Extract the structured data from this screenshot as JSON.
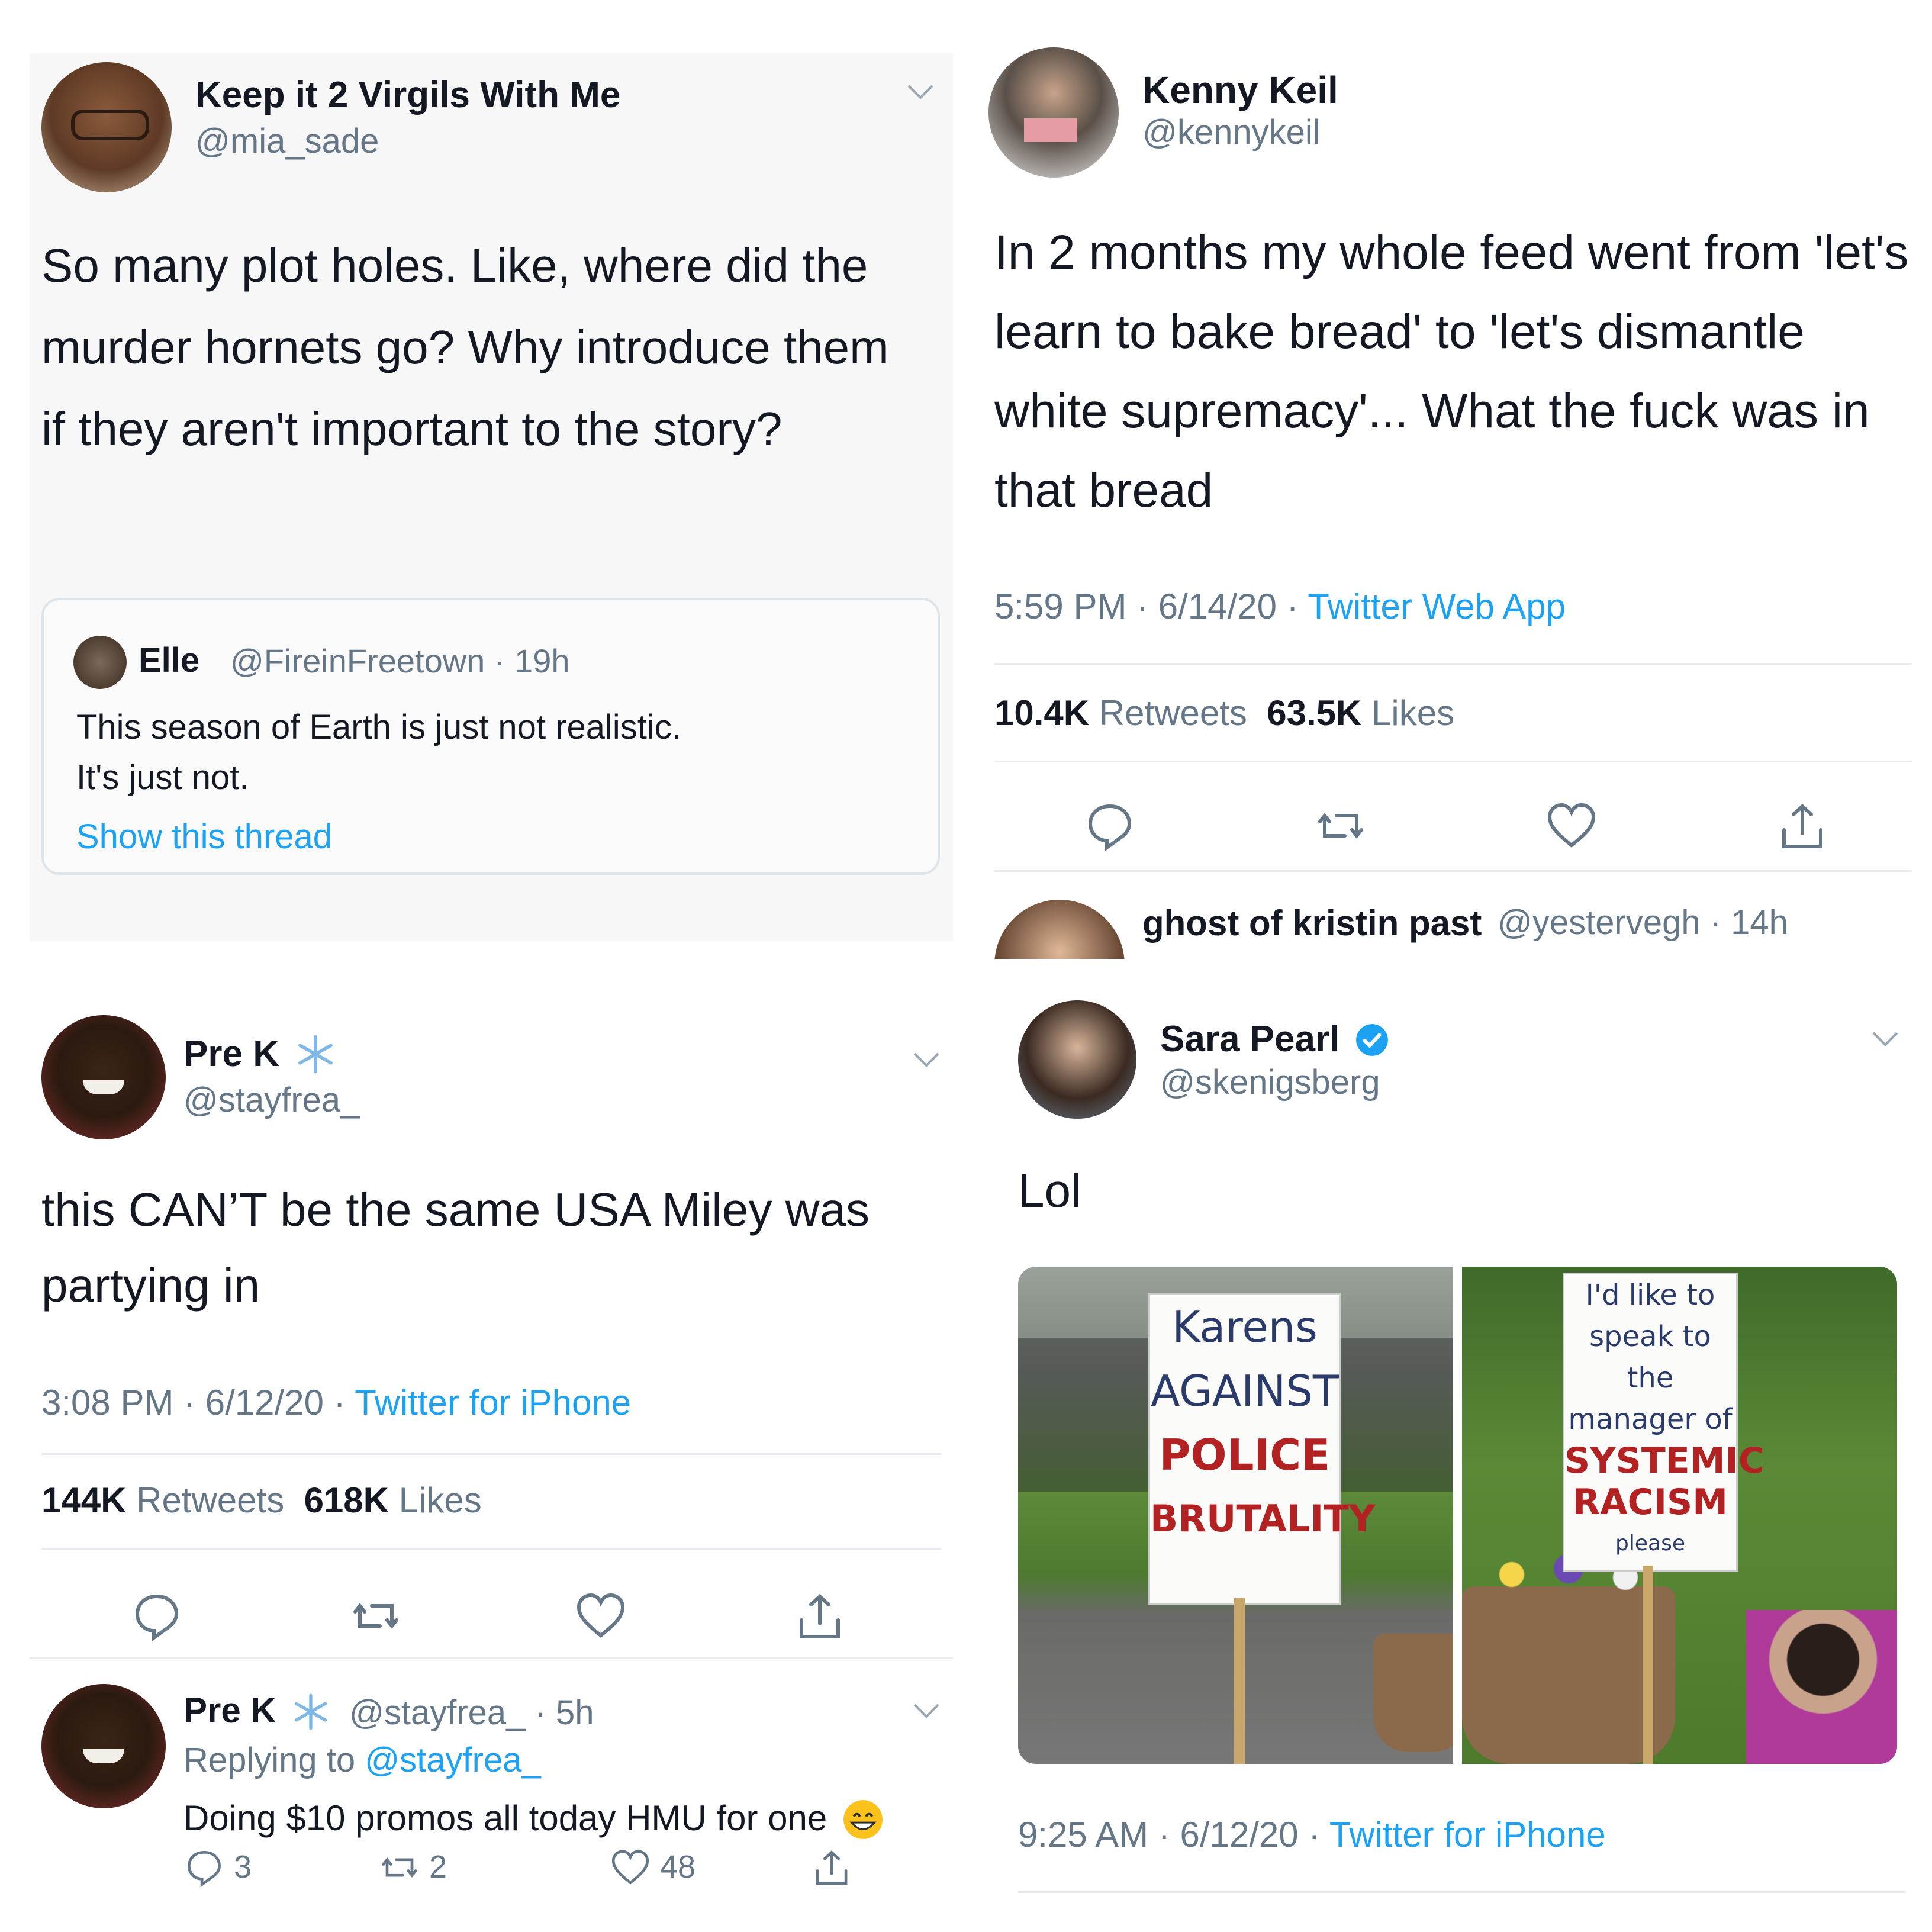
{
  "colors": {
    "accent": "#1da1f2",
    "text": "#141823",
    "muted": "#657786",
    "divider": "#e6ecf0",
    "verified": "#1da1f2"
  },
  "icons": [
    "chevron-down-icon",
    "reply-icon",
    "retweet-icon",
    "like-icon",
    "share-icon",
    "snowflake-icon",
    "verified-icon",
    "grin-emoji-icon"
  ],
  "tweet1": {
    "name": "Keep it 2 Virgils With Me",
    "handle": "@mia_sade",
    "text": "So many plot holes. Like, where did the murder hornets go? Why introduce them if they aren't important to the story?",
    "quote": {
      "name": "Elle",
      "handle_time": "@FireinFreetown · 19h",
      "line1": "This season of Earth is just not realistic.",
      "line2": "It's just not.",
      "show_thread": "Show this thread"
    }
  },
  "tweet2": {
    "name": "Kenny Keil",
    "handle": "@kennykeil",
    "text": "In 2 months my whole feed went from 'let's learn to bake bread' to 'let's dismantle white supremacy'... What the fuck was in that bread",
    "time": "5:59 PM · 6/14/20 · ",
    "source": "Twitter Web App",
    "retweets_count": "10.4K",
    "retweets_label": "Retweets",
    "likes_count": "63.5K",
    "likes_label": "Likes",
    "next_reply": {
      "name": "ghost of kristin past",
      "handle_time": "@yestervegh · 14h"
    }
  },
  "tweet3": {
    "name": "Pre K",
    "handle": "@stayfrea_",
    "text": "this CAN’T be the same USA Miley was partying in",
    "time": "3:08 PM · 6/12/20 · ",
    "source": "Twitter for iPhone",
    "retweets_count": "144K",
    "retweets_label": "Retweets",
    "likes_count": "618K",
    "likes_label": "Likes",
    "reply": {
      "name": "Pre K",
      "handle_time": "@stayfrea_ · 5h",
      "replying_prefix": "Replying to ",
      "replying_handle": "@stayfrea_",
      "text": "Doing $10 promos all today HMU for one",
      "reply_count": "3",
      "retweet_count": "2",
      "like_count": "48"
    }
  },
  "tweet4": {
    "name": "Sara Pearl",
    "handle": "@skenigsberg",
    "text": "Lol",
    "time": "9:25 AM · 6/12/20 · ",
    "source": "Twitter for iPhone",
    "sign1": [
      "Karens",
      "AGAINST",
      "POLICE",
      "BRUTALITY"
    ],
    "sign2": [
      "I'd like to",
      "speak to the",
      "manager of",
      "SYSTEMIC",
      "RACISM",
      "please"
    ]
  }
}
